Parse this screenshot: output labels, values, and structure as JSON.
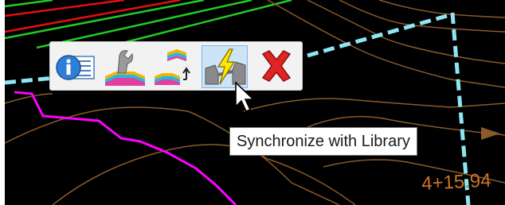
{
  "toolbar": {
    "buttons": [
      {
        "id": "properties",
        "icon": "info-panel-icon",
        "tooltip": ""
      },
      {
        "id": "edit-parameters",
        "icon": "wrench-corridor-icon",
        "tooltip": ""
      },
      {
        "id": "change-template",
        "icon": "template-swap-icon",
        "tooltip": ""
      },
      {
        "id": "synchronize",
        "icon": "synchronize-library-icon",
        "tooltip": "Synchronize with Library",
        "active": true
      },
      {
        "id": "delete",
        "icon": "red-x-icon",
        "tooltip": ""
      }
    ]
  },
  "tooltip": {
    "text": "Synchronize with Library"
  },
  "canvas": {
    "station_label": "4+15.94",
    "colors": {
      "background": "#000000",
      "contour": "#8a5a2b",
      "alignment_dashed": "#8ee6f2",
      "magenta_line": "#ff00ff",
      "green_lines": "#22cc22",
      "red_lines": "#e01010",
      "station_text": "#c8722a"
    }
  }
}
